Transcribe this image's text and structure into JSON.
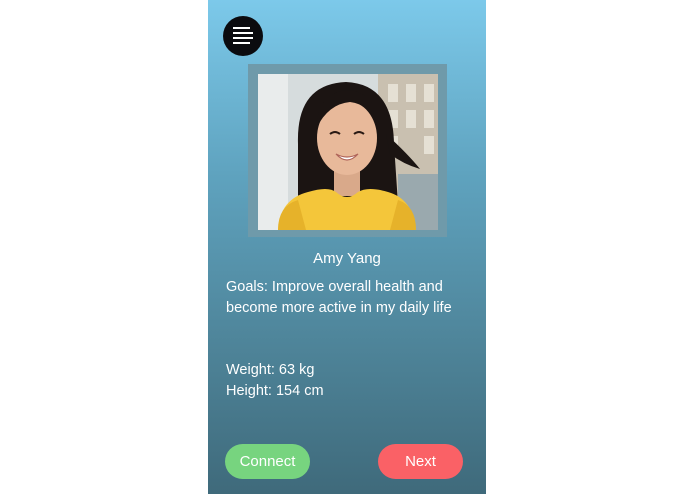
{
  "profile": {
    "name": "Amy Yang",
    "goals": "Goals: Improve overall health and become more active in my daily life",
    "weight": "Weight: 63 kg",
    "height": "Height: 154 cm"
  },
  "actions": {
    "connect_label": "Connect",
    "next_label": "Next"
  },
  "icons": {
    "menu": "menu-icon"
  },
  "colors": {
    "connect": "#77d47f",
    "next": "#fa6166",
    "menu_bg": "#0b0b0f"
  }
}
